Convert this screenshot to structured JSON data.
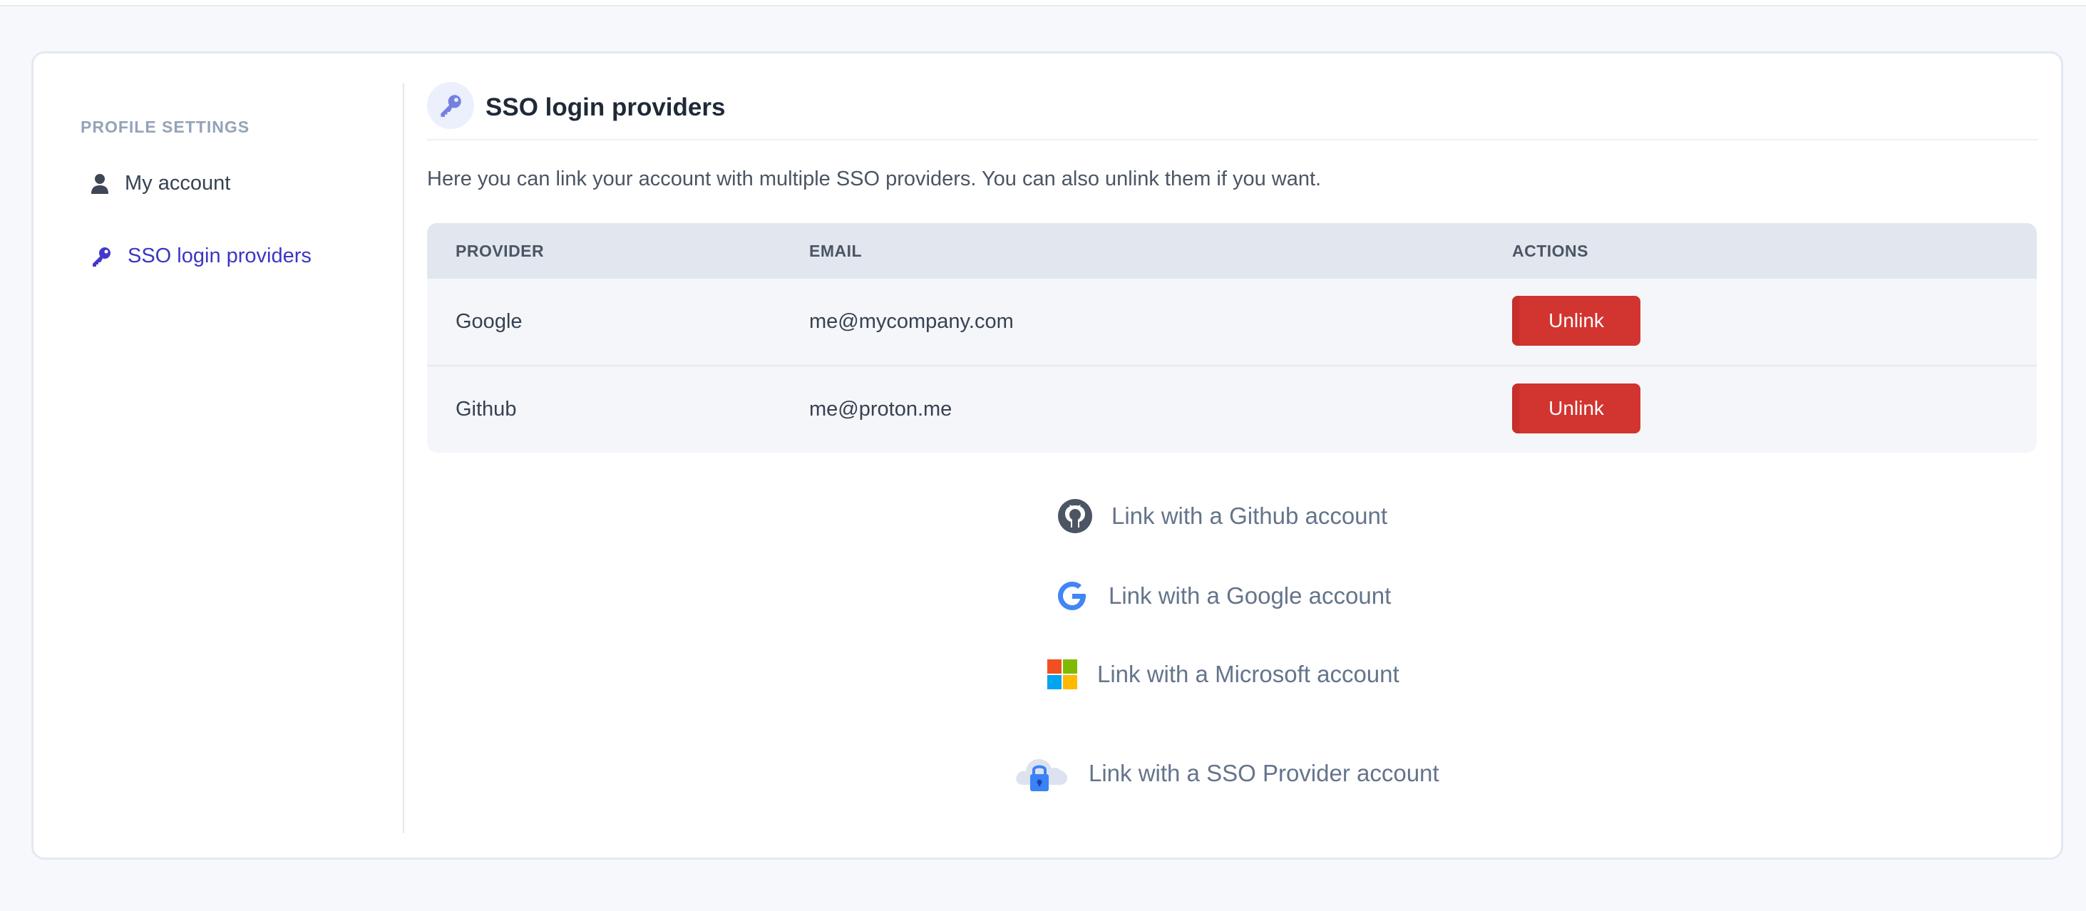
{
  "sidebar": {
    "section_title": "PROFILE SETTINGS",
    "items": [
      {
        "label": "My account",
        "icon": "user-icon",
        "active": false
      },
      {
        "label": "SSO login providers",
        "icon": "key-icon",
        "active": true
      }
    ]
  },
  "header": {
    "icon": "key-icon",
    "title": "SSO login providers"
  },
  "description": "Here you can link your account with multiple SSO providers. You can also unlink them if you want.",
  "table": {
    "columns": [
      "PROVIDER",
      "EMAIL",
      "ACTIONS"
    ],
    "rows": [
      {
        "provider": "Google",
        "email": "me@mycompany.com",
        "action": "Unlink"
      },
      {
        "provider": "Github",
        "email": "me@proton.me",
        "action": "Unlink"
      }
    ]
  },
  "link_options": [
    {
      "label": "Link with a Github account",
      "icon": "github-icon"
    },
    {
      "label": "Link with a Google account",
      "icon": "google-icon"
    },
    {
      "label": "Link with a Microsoft account",
      "icon": "microsoft-icon"
    },
    {
      "label": "Link with a SSO Provider account",
      "icon": "cloud-lock-icon"
    }
  ],
  "colors": {
    "accent": "#3b36c4",
    "danger": "#d2342f",
    "table_header": "#e2e7ef"
  }
}
